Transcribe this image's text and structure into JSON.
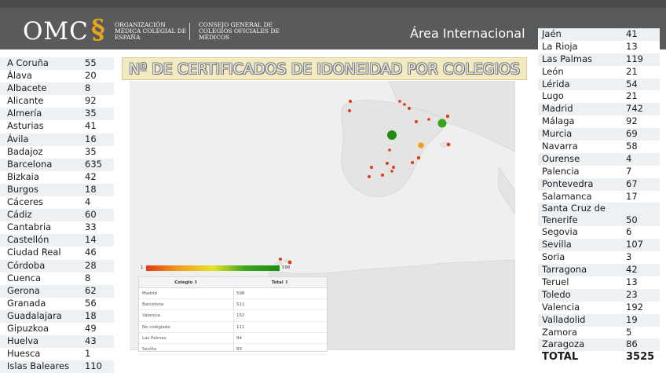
{
  "header": {
    "logo_text": "OMC",
    "logo_symbol": "§",
    "org1": "ORGANIZACIÓN MÉDICA COLEGIAL DE ESPAÑA",
    "org2": "CONSEJO GENERAL DE COLEGIOS OFICIALES DE MÉDICOS",
    "area": "Área Internacional",
    "colors": {
      "band": "#595a5c",
      "accent": "#e8a319"
    }
  },
  "banner": {
    "title": "Nº DE CERTIFICADOS  DE IDONEIDAD POR COLEGIOS"
  },
  "left_table": [
    {
      "name": "A Coruña",
      "value": "55"
    },
    {
      "name": "Álava",
      "value": "20"
    },
    {
      "name": "Albacete",
      "value": "8"
    },
    {
      "name": "Alicante",
      "value": "92"
    },
    {
      "name": "Almería",
      "value": "35"
    },
    {
      "name": "Asturias",
      "value": "41"
    },
    {
      "name": "Ávila",
      "value": "16"
    },
    {
      "name": "Badajoz",
      "value": "35"
    },
    {
      "name": "Barcelona",
      "value": "635"
    },
    {
      "name": "Bizkaia",
      "value": "42"
    },
    {
      "name": "Burgos",
      "value": "18"
    },
    {
      "name": "Cáceres",
      "value": "4"
    },
    {
      "name": "Cádiz",
      "value": "60"
    },
    {
      "name": "Cantabria",
      "value": "33"
    },
    {
      "name": "Castellón",
      "value": "14"
    },
    {
      "name": "Ciudad Real",
      "value": "46"
    },
    {
      "name": "Córdoba",
      "value": "28"
    },
    {
      "name": "Cuenca",
      "value": "8"
    },
    {
      "name": "Gerona",
      "value": "62"
    },
    {
      "name": "Granada",
      "value": "56"
    },
    {
      "name": "Guadalajara",
      "value": "18"
    },
    {
      "name": "Gipuzkoa",
      "value": "49"
    },
    {
      "name": "Huelva",
      "value": "43"
    },
    {
      "name": "Huesca",
      "value": "1"
    },
    {
      "name": "Islas Baleares",
      "value": "110"
    }
  ],
  "right_table": [
    {
      "name": "Jaén",
      "value": "41"
    },
    {
      "name": "La Rioja",
      "value": "13"
    },
    {
      "name": "Las Palmas",
      "value": "119"
    },
    {
      "name": "León",
      "value": "21"
    },
    {
      "name": "Lérida",
      "value": "54"
    },
    {
      "name": "Lugo",
      "value": "21"
    },
    {
      "name": "Madrid",
      "value": "742"
    },
    {
      "name": "Málaga",
      "value": "92"
    },
    {
      "name": "Murcia",
      "value": "69"
    },
    {
      "name": "Navarra",
      "value": "58"
    },
    {
      "name": "Ourense",
      "value": "4"
    },
    {
      "name": "Palencia",
      "value": "7"
    },
    {
      "name": "Pontevedra",
      "value": "67"
    },
    {
      "name": "Salamanca",
      "value": "17"
    },
    {
      "name": "Santa Cruz de Tenerife",
      "value": "50"
    },
    {
      "name": "Segovia",
      "value": "6"
    },
    {
      "name": "Sevilla",
      "value": "107"
    },
    {
      "name": "Soria",
      "value": "3"
    },
    {
      "name": "Tarragona",
      "value": "42"
    },
    {
      "name": "Teruel",
      "value": "13"
    },
    {
      "name": "Toledo",
      "value": "23"
    },
    {
      "name": "Valencia",
      "value": "192"
    },
    {
      "name": "Valladolid",
      "value": "19"
    },
    {
      "name": "Zamora",
      "value": "5"
    },
    {
      "name": "Zaragoza",
      "value": "86"
    }
  ],
  "total": {
    "label": "TOTAL",
    "value": "3525"
  },
  "map": {
    "scale_min": "1",
    "scale_max": "598",
    "scale_colors": [
      "#e23a16",
      "#f0a01e",
      "#e6e22a",
      "#3aa31e",
      "#1f8c13"
    ],
    "marker_colors": {
      "high": "#1f8c13",
      "mid": "#f0a01e",
      "low": "#e23a16"
    }
  },
  "grid": {
    "headers": [
      "Colegio ⇕",
      "Total ⇕"
    ],
    "rows": [
      {
        "colegio": "Madrid",
        "total": "598"
      },
      {
        "colegio": "Barcelona",
        "total": "511"
      },
      {
        "colegio": "Valencia",
        "total": "151"
      },
      {
        "colegio": "No colegiado",
        "total": "111"
      },
      {
        "colegio": "Las Palmas",
        "total": "94"
      },
      {
        "colegio": "Sevilla",
        "total": "83"
      }
    ]
  }
}
